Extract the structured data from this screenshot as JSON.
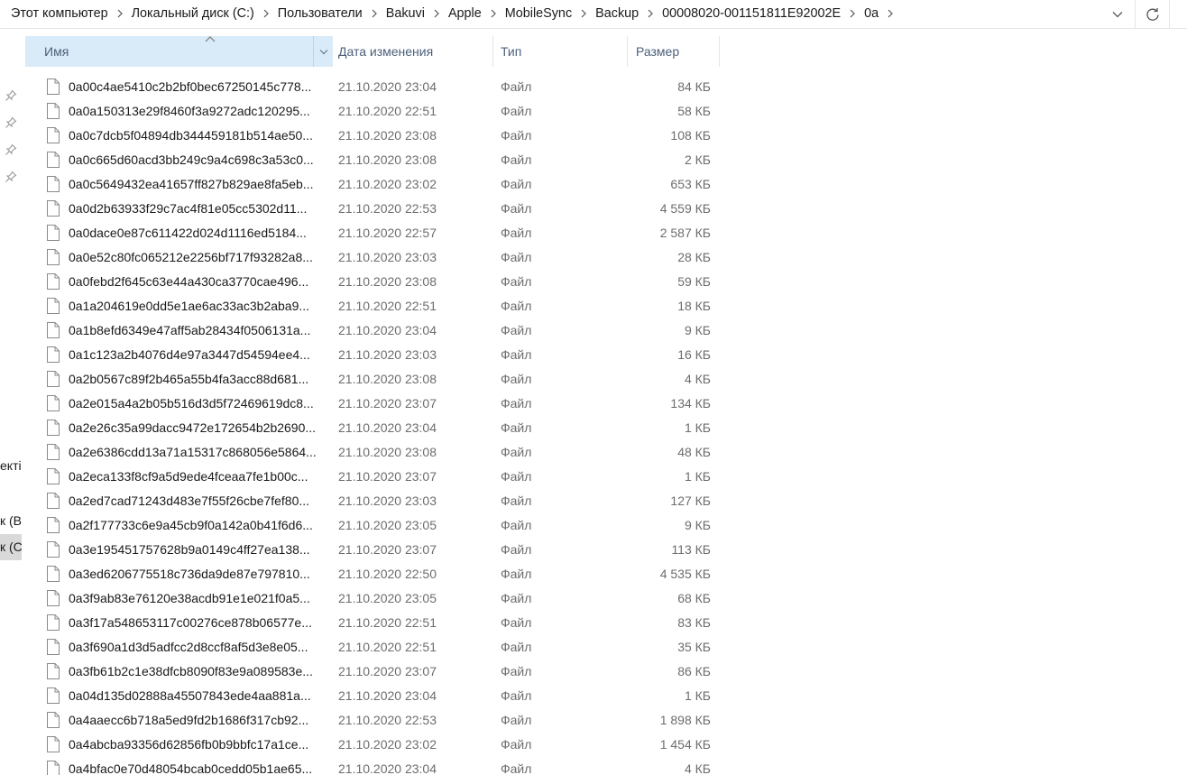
{
  "breadcrumb": [
    "Этот компьютер",
    "Локальный диск (C:)",
    "Пользователи",
    "Bakuvi",
    "Apple",
    "MobileSync",
    "Backup",
    "00008020-001151811E92002E",
    "0a"
  ],
  "nav_pane": {
    "partial_items": [
      "екті",
      "к (В",
      "к (С"
    ]
  },
  "columns": {
    "name": "Имя",
    "date": "Дата изменения",
    "type": "Тип",
    "size": "Размер"
  },
  "files": [
    {
      "name": "0a00c4ae5410c2b2bf0bec67250145c778...",
      "date": "21.10.2020 23:04",
      "type": "Файл",
      "size": "84 КБ"
    },
    {
      "name": "0a0a150313e29f8460f3a9272adc120295...",
      "date": "21.10.2020 22:51",
      "type": "Файл",
      "size": "58 КБ"
    },
    {
      "name": "0a0c7dcb5f04894db344459181b514ae50...",
      "date": "21.10.2020 23:08",
      "type": "Файл",
      "size": "108 КБ"
    },
    {
      "name": "0a0c665d60acd3bb249c9a4c698c3a53c0...",
      "date": "21.10.2020 23:08",
      "type": "Файл",
      "size": "2 КБ"
    },
    {
      "name": "0a0c5649432ea41657ff827b829ae8fa5eb...",
      "date": "21.10.2020 23:02",
      "type": "Файл",
      "size": "653 КБ"
    },
    {
      "name": "0a0d2b63933f29c7ac4f81e05cc5302d11...",
      "date": "21.10.2020 22:53",
      "type": "Файл",
      "size": "4 559 КБ"
    },
    {
      "name": "0a0dace0e87c611422d024d1116ed5184...",
      "date": "21.10.2020 22:57",
      "type": "Файл",
      "size": "2 587 КБ"
    },
    {
      "name": "0a0e52c80fc065212e2256bf717f93282a8...",
      "date": "21.10.2020 23:03",
      "type": "Файл",
      "size": "28 КБ"
    },
    {
      "name": "0a0febd2f645c63e44a430ca3770cae496...",
      "date": "21.10.2020 23:08",
      "type": "Файл",
      "size": "59 КБ"
    },
    {
      "name": "0a1a204619e0dd5e1ae6ac33ac3b2aba9...",
      "date": "21.10.2020 22:51",
      "type": "Файл",
      "size": "18 КБ"
    },
    {
      "name": "0a1b8efd6349e47aff5ab28434f0506131a...",
      "date": "21.10.2020 23:04",
      "type": "Файл",
      "size": "9 КБ"
    },
    {
      "name": "0a1c123a2b4076d4e97a3447d54594ee4...",
      "date": "21.10.2020 23:03",
      "type": "Файл",
      "size": "16 КБ"
    },
    {
      "name": "0a2b0567c89f2b465a55b4fa3acc88d681...",
      "date": "21.10.2020 23:08",
      "type": "Файл",
      "size": "4 КБ"
    },
    {
      "name": "0a2e015a4a2b05b516d3d5f72469619dc8...",
      "date": "21.10.2020 23:07",
      "type": "Файл",
      "size": "134 КБ"
    },
    {
      "name": "0a2e26c35a99dacc9472e172654b2b2690...",
      "date": "21.10.2020 23:04",
      "type": "Файл",
      "size": "1 КБ"
    },
    {
      "name": "0a2e6386cdd13a71a15317c868056e5864...",
      "date": "21.10.2020 23:08",
      "type": "Файл",
      "size": "48 КБ"
    },
    {
      "name": "0a2eca133f8cf9a5d9ede4fceaa7fe1b00c...",
      "date": "21.10.2020 23:07",
      "type": "Файл",
      "size": "1 КБ"
    },
    {
      "name": "0a2ed7cad71243d483e7f55f26cbe7fef80...",
      "date": "21.10.2020 23:03",
      "type": "Файл",
      "size": "127 КБ"
    },
    {
      "name": "0a2f177733c6e9a45cb9f0a142a0b41f6d6...",
      "date": "21.10.2020 23:05",
      "type": "Файл",
      "size": "9 КБ"
    },
    {
      "name": "0a3e195451757628b9a0149c4ff27ea138...",
      "date": "21.10.2020 23:07",
      "type": "Файл",
      "size": "113 КБ"
    },
    {
      "name": "0a3ed6206775518c736da9de87e797810...",
      "date": "21.10.2020 22:50",
      "type": "Файл",
      "size": "4 535 КБ"
    },
    {
      "name": "0a3f9ab83e76120e38acdb91e1e021f0a5...",
      "date": "21.10.2020 23:05",
      "type": "Файл",
      "size": "68 КБ"
    },
    {
      "name": "0a3f17a548653117c00276ce878b06577e...",
      "date": "21.10.2020 22:51",
      "type": "Файл",
      "size": "83 КБ"
    },
    {
      "name": "0a3f690a1d3d5adfcc2d8ccf8af5d3e8e05...",
      "date": "21.10.2020 22:51",
      "type": "Файл",
      "size": "35 КБ"
    },
    {
      "name": "0a3fb61b2c1e38dfcb8090f83e9a089583e...",
      "date": "21.10.2020 23:07",
      "type": "Файл",
      "size": "86 КБ"
    },
    {
      "name": "0a04d135d02888a45507843ede4aa881a...",
      "date": "21.10.2020 23:04",
      "type": "Файл",
      "size": "1 КБ"
    },
    {
      "name": "0a4aaecc6b718a5ed9fd2b1686f317cb92...",
      "date": "21.10.2020 22:53",
      "type": "Файл",
      "size": "1 898 КБ"
    },
    {
      "name": "0a4abcba93356d62856fb0b9bbfc17a1ce...",
      "date": "21.10.2020 23:02",
      "type": "Файл",
      "size": "1 454 КБ"
    },
    {
      "name": "0a4bfac0e70d48054bcab0cedd05b1ae65...",
      "date": "21.10.2020 23:04",
      "type": "Файл",
      "size": "4 КБ"
    }
  ]
}
